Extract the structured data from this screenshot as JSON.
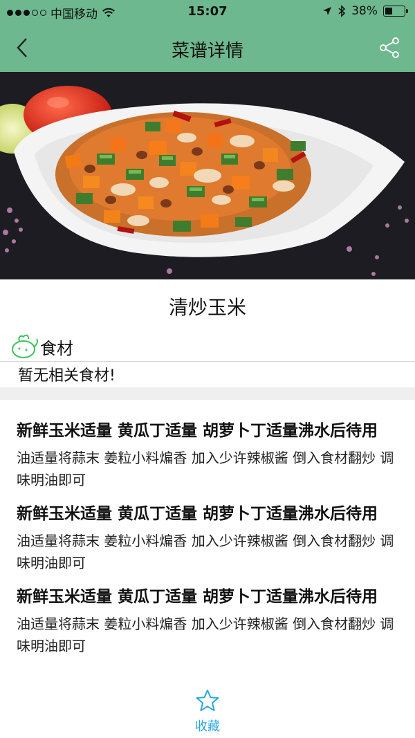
{
  "status_bar": {
    "carrier": "中国移动",
    "time": "15:07",
    "battery": "38%",
    "battery_level": 0.38
  },
  "navbar": {
    "title": "菜谱详情",
    "back_icon": "chevron-left-icon",
    "share_icon": "share-icon"
  },
  "recipe": {
    "name": "清炒玉米",
    "ingredients_label": "食材",
    "ingredients_empty": "暂无相关食材!",
    "steps": [
      {
        "head": "新鲜玉米适量 黄瓜丁适量 胡萝卜丁适量沸水后待用",
        "desc": "油适量将蒜末 姜粒小料煸香 加入少许辣椒酱 倒入食材翻炒 调味明油即可"
      },
      {
        "head": "新鲜玉米适量 黄瓜丁适量 胡萝卜丁适量沸水后待用",
        "desc": "油适量将蒜末 姜粒小料煸香 加入少许辣椒酱 倒入食材翻炒 调味明油即可"
      },
      {
        "head": "新鲜玉米适量 黄瓜丁适量 胡萝卜丁适量沸水后待用",
        "desc": "油适量将蒜末 姜粒小料煸香 加入少许辣椒酱 倒入食材翻炒 调味明油即可"
      }
    ]
  },
  "bottom": {
    "favorite_label": "收藏",
    "favorite_icon": "star-icon"
  },
  "colors": {
    "header_green": "#6db88e",
    "accent_blue": "#29a7e0"
  }
}
